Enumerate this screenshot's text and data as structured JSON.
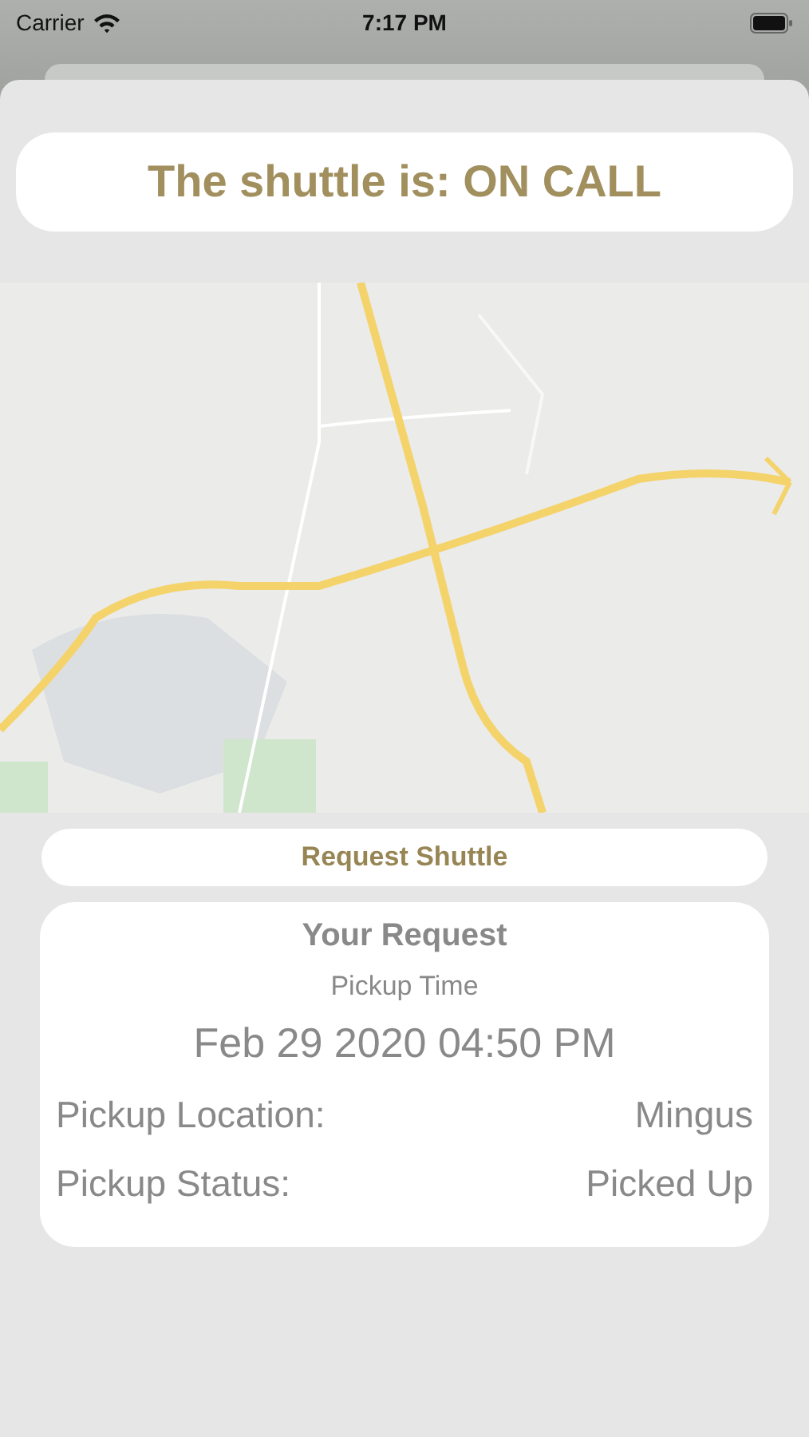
{
  "status_bar": {
    "carrier": "Carrier",
    "time": "7:17 PM"
  },
  "shuttle_status": {
    "text": "The shuttle is: ON CALL"
  },
  "request_button": {
    "label": "Request Shuttle"
  },
  "request": {
    "title": "Your Request",
    "time_label": "Pickup Time",
    "time": "Feb 29 2020 04:50 PM",
    "rows": [
      {
        "label": "Pickup Location:",
        "value": "Mingus"
      },
      {
        "label": "Pickup Status:",
        "value": "Picked Up"
      }
    ]
  }
}
